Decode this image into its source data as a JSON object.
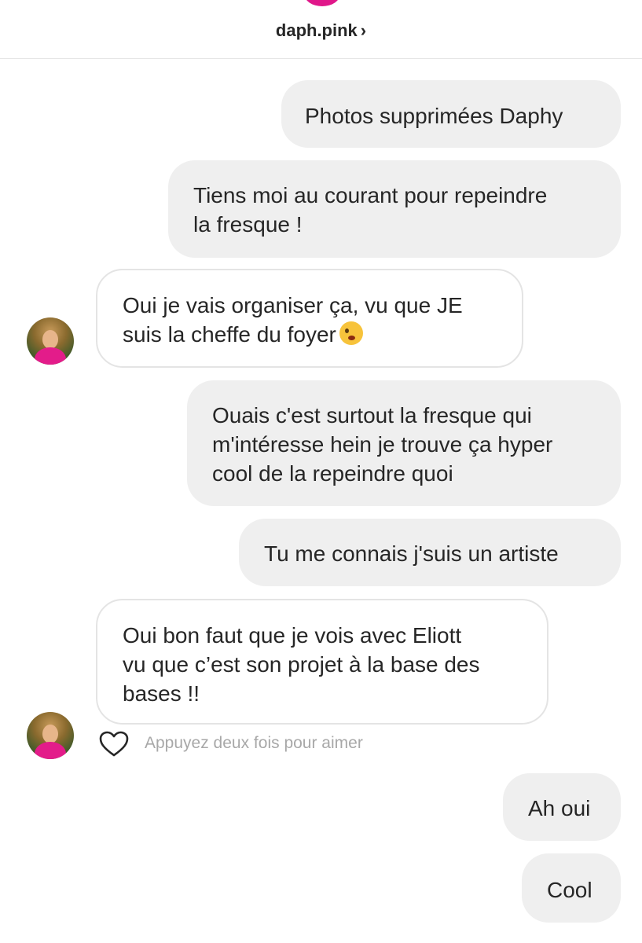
{
  "header": {
    "username": "daph.pink",
    "chevron": "›"
  },
  "messages": [
    {
      "from": "me",
      "text": "Photos supprimées Daphy"
    },
    {
      "from": "me",
      "lines": [
        "Tiens moi au courant pour repeindre",
        "la fresque !"
      ]
    },
    {
      "from": "them",
      "lines": [
        "Oui je vais organiser ça, vu que JE",
        "suis la cheffe du foyer"
      ],
      "emoji": "winking-face-icon"
    },
    {
      "from": "me",
      "lines": [
        "Ouais c'est surtout la fresque qui",
        "m'intéresse hein je trouve ça hyper",
        "cool de la repeindre quoi"
      ]
    },
    {
      "from": "me",
      "text": "Tu me connais j'suis un artiste"
    },
    {
      "from": "them",
      "lines": [
        "Oui bon faut que je vois avec Eliott",
        "vu que c’est son projet à la base des",
        "bases !!"
      ]
    },
    {
      "from": "me",
      "text": "Ah oui"
    },
    {
      "from": "me",
      "text": "Cool"
    }
  ],
  "like_hint": "Appuyez deux fois pour aimer",
  "icons": {
    "heart": "heart-outline-icon",
    "avatar": "profile-avatar"
  },
  "colors": {
    "sent_bubble": "#efefef",
    "received_border": "#e4e4e4",
    "hint_text": "#a8a8a8",
    "header_avatar": "#e0178a"
  }
}
